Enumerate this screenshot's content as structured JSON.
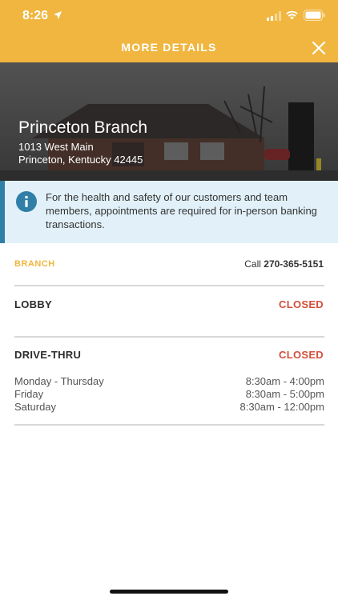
{
  "status_bar": {
    "time": "8:26",
    "icons": [
      "location-arrow-icon",
      "signal-icon",
      "wifi-icon",
      "battery-icon"
    ]
  },
  "nav": {
    "title": "MORE DETAILS",
    "close_icon": "close-icon"
  },
  "hero": {
    "name": "Princeton Branch",
    "address_line1": "1013 West Main",
    "address_line2": "Princeton, Kentucky 42445"
  },
  "notice": {
    "icon": "info-icon",
    "text": "For the health and safety of our customers and team members, appointments are required for in-person banking transactions."
  },
  "branch": {
    "label": "BRANCH",
    "call_prefix": "Call",
    "phone": "270-365-5151"
  },
  "lobby": {
    "label": "LOBBY",
    "status": "CLOSED"
  },
  "drive_thru": {
    "label": "DRIVE-THRU",
    "status": "CLOSED",
    "hours": [
      {
        "days": "Monday - Thursday",
        "time": "8:30am - 4:00pm"
      },
      {
        "days": "Friday",
        "time": "8:30am - 5:00pm"
      },
      {
        "days": "Saturday",
        "time": "8:30am - 12:00pm"
      }
    ]
  },
  "colors": {
    "accent": "#f0b640",
    "closed": "#d34f3c",
    "notice_bg": "#e2f1f9",
    "notice_bar": "#2f7fa7"
  }
}
